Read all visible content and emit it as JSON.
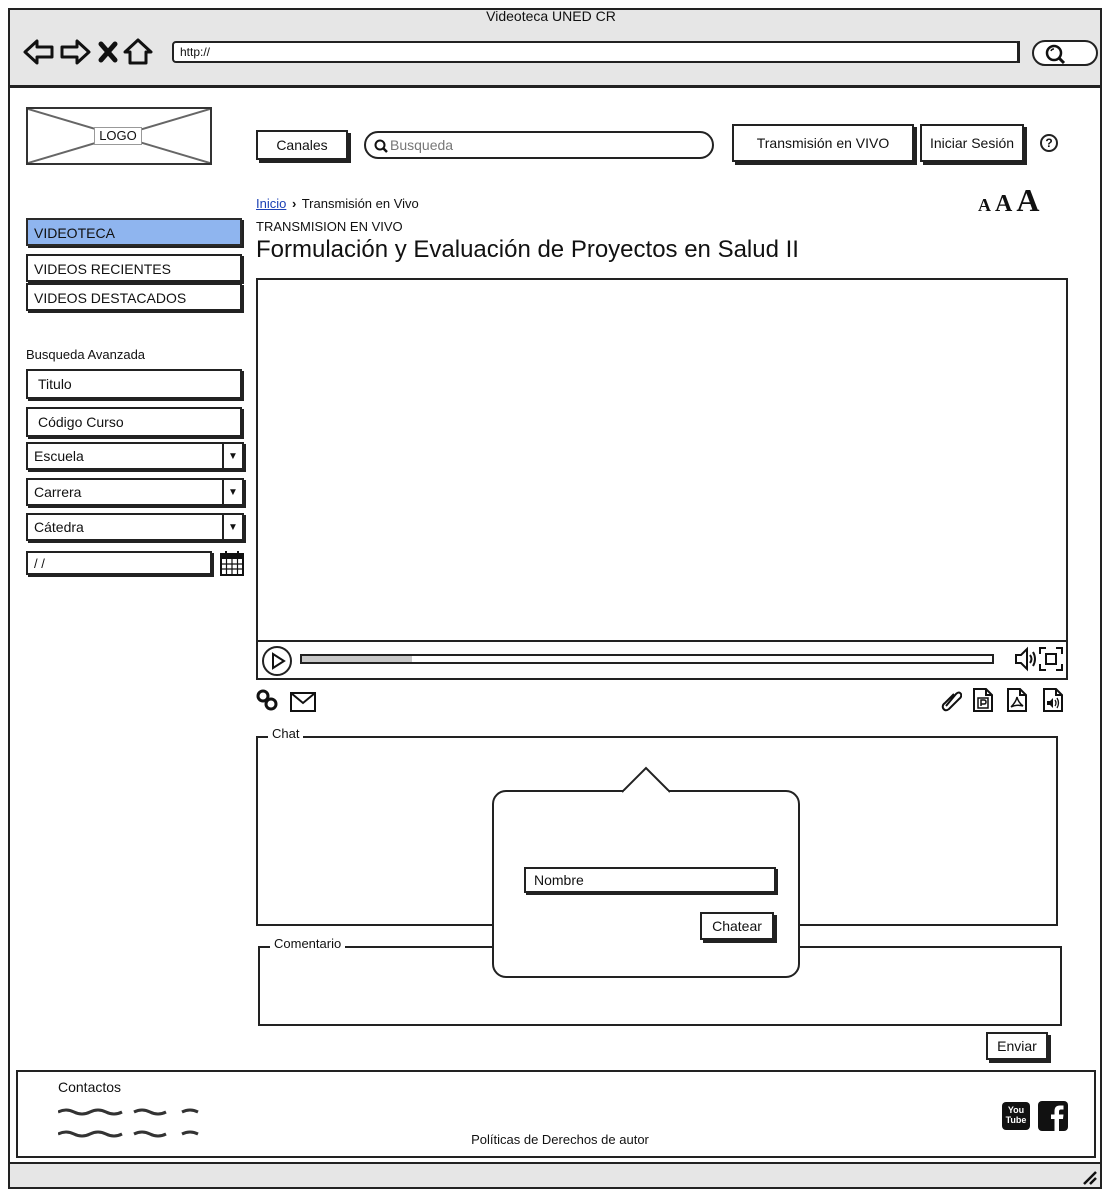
{
  "browser": {
    "window_title": "Videoteca UNED CR",
    "url": "http://"
  },
  "header": {
    "logo_label": "LOGO",
    "channels_button": "Canales",
    "search_placeholder": "Busqueda",
    "live_button": "Transmisión en VIVO",
    "login_button": "Iniciar Sesión",
    "help_icon": "?",
    "font_sizes": [
      "A",
      "A",
      "A"
    ]
  },
  "breadcrumb": {
    "home": "Inicio",
    "separator": "›",
    "current": "Transmisión en Vivo"
  },
  "page": {
    "subtitle": "TRANSMISION EN VIVO",
    "title": "Formulación y Evaluación de Proyectos en Salud II"
  },
  "sidebar": {
    "items": [
      {
        "label": "VIDEOTECA",
        "active": true
      },
      {
        "label": "VIDEOS RECIENTES",
        "active": false
      },
      {
        "label": "VIDEOS DESTACADOS",
        "active": false
      }
    ],
    "advanced_search": {
      "label": "Busqueda Avanzada",
      "title_field": "Titulo",
      "course_code_field": "Código Curso",
      "school_select": "Escuela",
      "career_select": "Carrera",
      "chair_select": "Cátedra",
      "date_field": "/ /"
    }
  },
  "video": {
    "progress_fraction": 0.16
  },
  "chat": {
    "legend": "Chat",
    "name_field": "Nombre",
    "chat_button": "Chatear"
  },
  "comment": {
    "legend": "Comentario",
    "send_button": "Enviar"
  },
  "footer": {
    "contacts_label": "Contactos",
    "policy": "Políticas de Derechos de autor",
    "youtube_text": "You Tube"
  },
  "colors": {
    "active_nav": "#8fb5ef",
    "link": "#1a3fb5",
    "chrome": "#e6e6e6"
  }
}
